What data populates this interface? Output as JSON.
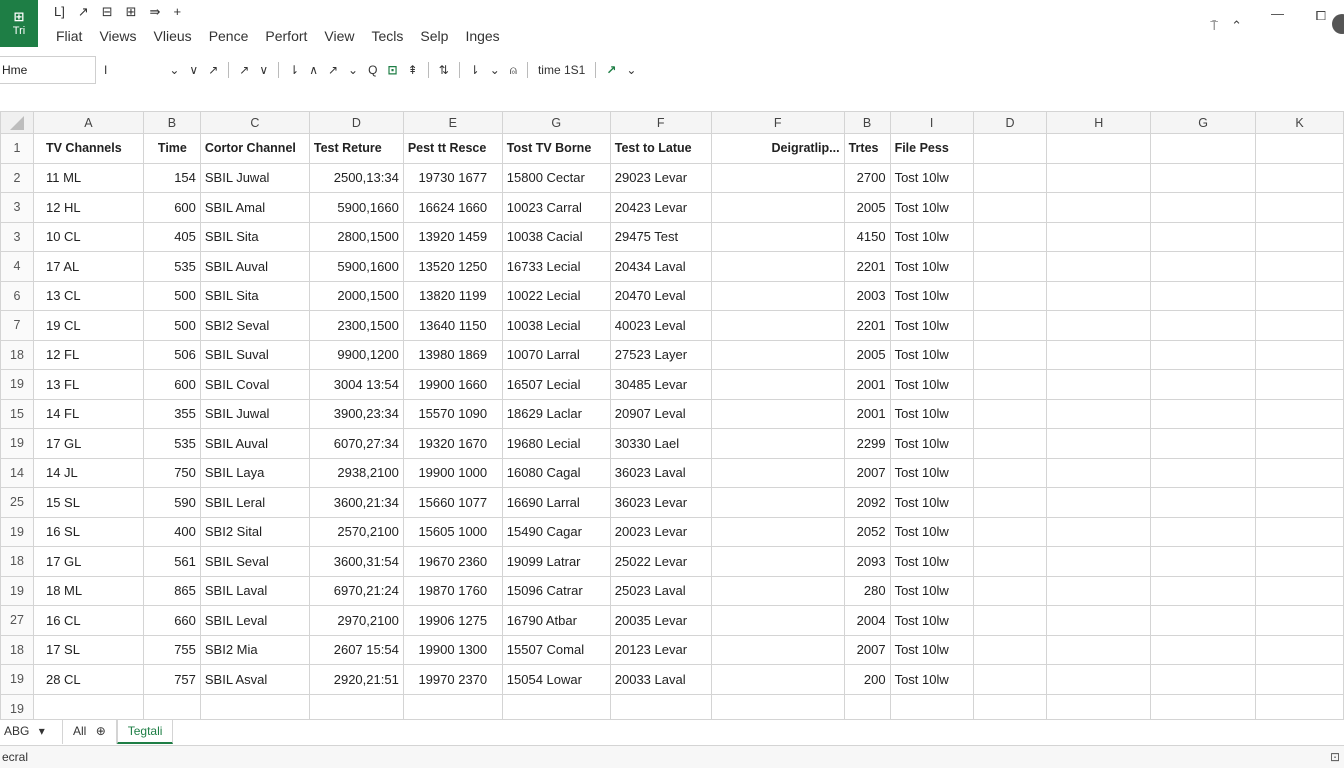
{
  "app": {
    "icon_glyph": "⊞",
    "icon_label": "Tri",
    "brand_color": "#1e7e45"
  },
  "quick_tools": [
    "L]",
    "↗",
    "⊟",
    "⊞",
    "⇛",
    "+"
  ],
  "menu": [
    "Fliat",
    "Views",
    "Vlieus",
    "Pence",
    "Perfort",
    "View",
    "Tecls",
    "Selp",
    "Inges"
  ],
  "window_controls": {
    "help": "⍑",
    "minimize": "—",
    "restore": "⧠"
  },
  "name_box": "Hme",
  "formula_tools": [
    "I",
    "⌄",
    "∨",
    "↗",
    "↗",
    "∨",
    "⇂",
    "∧",
    "↗",
    "⌄",
    "Q",
    "⊡",
    "⇞",
    "⇅",
    "⇂",
    "⌄",
    "⍝",
    "time 1S1",
    "↗",
    "⌄"
  ],
  "columns": [
    "A",
    "B",
    "C",
    "D",
    "E",
    "G",
    "F",
    "F",
    "B",
    "I",
    "D",
    "H",
    "G",
    "K"
  ],
  "header_row_num": "1",
  "headers": [
    "TV Channels",
    "Time",
    "Cortor Channel",
    "Test Reture",
    "Pest tt Resce",
    "Tost TV Borne",
    "Test to Latue",
    "Deigratlip...",
    "Trtes",
    "File Pess",
    "",
    "",
    "",
    ""
  ],
  "rows": [
    {
      "num": "2",
      "cells": [
        "11  ML",
        "154",
        "SBIL Juwal",
        "2500,13:34",
        "19730 1677",
        "15800 Cectar",
        "29023 Levar",
        "",
        "2700",
        "Tost 10lw"
      ]
    },
    {
      "num": "3",
      "cells": [
        "12  HL",
        "600",
        "SBIL Amal",
        "5900,1660",
        "16624 1660",
        "10023 Carral",
        "20423 Levar",
        "",
        "2005",
        "Tost 10lw"
      ]
    },
    {
      "num": "3",
      "cells": [
        "10  CL",
        "405",
        "SBIL Sita",
        "2800,1500",
        "13920 1459",
        "10038 Cacial",
        "29475 Test",
        "",
        "4150",
        "Tost 10lw"
      ]
    },
    {
      "num": "4",
      "cells": [
        "17  AL",
        "535",
        "SBIL Auval",
        "5900,1600",
        "13520 1250",
        "16733 Lecial",
        "20434 Laval",
        "",
        "2201",
        "Tost 10lw"
      ]
    },
    {
      "num": "6",
      "cells": [
        "13  CL",
        "500",
        "SBIL Sita",
        "2000,1500",
        "13820 1199",
        "10022 Lecial",
        "20470 Leval",
        "",
        "2003",
        "Tost 10lw"
      ]
    },
    {
      "num": "7",
      "cells": [
        "19  CL",
        "500",
        "SBI2 Seval",
        "2300,1500",
        "13640 1150",
        "10038 Lecial",
        "40023 Leval",
        "",
        "2201",
        "Tost 10lw"
      ]
    },
    {
      "num": "18",
      "cells": [
        "12  FL",
        "506",
        "SBIL Suval",
        "9900,1200",
        "13980 1869",
        "10070 Larral",
        "27523 Layer",
        "",
        "2005",
        "Tost 10lw"
      ]
    },
    {
      "num": "19",
      "cells": [
        "13  FL",
        "600",
        "SBIL Coval",
        "3004 13:54",
        "19900 1660",
        "16507 Lecial",
        "30485 Levar",
        "",
        "2001",
        "Tost 10lw"
      ]
    },
    {
      "num": "15",
      "cells": [
        "14  FL",
        "355",
        "SBIL Juwal",
        "3900,23:34",
        "15570 1090",
        "18629 Laclar",
        "20907 Leval",
        "",
        "2001",
        "Tost 10lw"
      ]
    },
    {
      "num": "19",
      "cells": [
        "17  GL",
        "535",
        "SBIL Auval",
        "6070,27:34",
        "19320 1670",
        "19680 Lecial",
        "30330 Lael",
        "",
        "2299",
        "Tost 10lw"
      ]
    },
    {
      "num": "14",
      "cells": [
        "14  JL",
        "750",
        "SBIL Laya",
        "2938,2100",
        "19900 1000",
        "16080 Cagal",
        "36023 Laval",
        "",
        "2007",
        "Tost 10lw"
      ]
    },
    {
      "num": "25",
      "cells": [
        "15  SL",
        "590",
        "SBIL Leral",
        "3600,21:34",
        "15660 1077",
        "16690 Larral",
        "36023 Levar",
        "",
        "2092",
        "Tost 10lw"
      ]
    },
    {
      "num": "19",
      "cells": [
        "16  SL",
        "400",
        "SBI2 Sital",
        "2570,2100",
        "15605 1000",
        "15490 Cagar",
        "20023 Levar",
        "",
        "2052",
        "Tost 10lw"
      ]
    },
    {
      "num": "18",
      "cells": [
        "17  GL",
        "561",
        "SBIL Seval",
        "3600,31:54",
        "19670 2360",
        "19099 Latrar",
        "25022 Levar",
        "",
        "2093",
        "Tost 10lw"
      ]
    },
    {
      "num": "19",
      "cells": [
        "18  ML",
        "865",
        "SBIL Laval",
        "6970,21:24",
        "19870 1760",
        "15096 Catrar",
        "25023 Laval",
        "",
        "280",
        "Tost 10lw"
      ]
    },
    {
      "num": "27",
      "cells": [
        "16  CL",
        "660",
        "SBIL Leval",
        "2970,2100",
        "19906 1275",
        "16790 Atbar",
        "20035 Levar",
        "",
        "2004",
        "Tost 10lw"
      ]
    },
    {
      "num": "18",
      "cells": [
        "17  SL",
        "755",
        "SBI2 Mia",
        "2607 15:54",
        "19900 1300",
        "15507 Comal",
        "20123 Levar",
        "",
        "2007",
        "Tost 10lw"
      ]
    },
    {
      "num": "19",
      "cells": [
        "28  CL",
        "757",
        "SBIL Asval",
        "2920,21:51",
        "19970 2370",
        "15054 Lowar",
        "20033 Laval",
        "",
        "200",
        "Tost 10lw"
      ]
    },
    {
      "num": "19",
      "cells": [
        "",
        "",
        "",
        "",
        "",
        "",
        "",
        "",
        "",
        ""
      ]
    }
  ],
  "sheets": {
    "nav_label": "ABG",
    "nav_arrow": "▾",
    "tabs": [
      {
        "label": "All",
        "extra": "⊕",
        "active": false
      },
      {
        "label": "Tegtali",
        "extra": "",
        "active": true
      }
    ]
  },
  "status": {
    "text": "ecral",
    "icon": "⊡"
  }
}
